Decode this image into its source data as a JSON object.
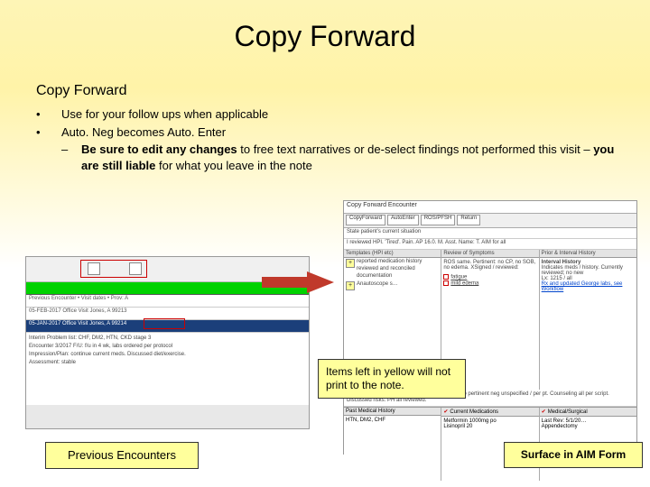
{
  "title": "Copy Forward",
  "subtitle": "Copy Forward",
  "bullets": {
    "items": [
      "Use for your follow ups when applicable",
      "Auto. Neg becomes Auto. Enter"
    ],
    "sub_prefix": "Be sure to edit any changes",
    "sub_mid": " to free text narratives or de-select findings not performed this visit – ",
    "sub_bold2": "you are still liable",
    "sub_tail": " for what you leave in the note"
  },
  "left": {
    "row1": "Previous Encounter  •  Visit dates  •  Prov: A",
    "row2": "05-FEB-2017   Office Visit   Jones, A   99213",
    "row3": "05-JAN-2017   Office Visit   Jones, A   99214",
    "body1": "Interim Problem list: CHF, DM2, HTN, CKD stage 3",
    "body2": "Encounter 3/2017 F/U: f/u in 4 wk, labs ordered per protocol",
    "body3": "Impression/Plan: continue current meds. Discussed diet/exercise.",
    "body4": "Assessment: stable"
  },
  "right": {
    "titlebar": "Copy Forward Encounter",
    "toolbar": [
      "CopyForward",
      "AutoEnter",
      "ROS/PFSH",
      "Return"
    ],
    "sub1": "State patient's current situation",
    "sub2": "I reviewed HPI.  'Tired'. Pain.  AP 16.0.  M.  Asst. Name: T. AIM for all",
    "col1_h": "Templates (HPI etc)",
    "col1_items": [
      "reported medication history reviewed and reconciled documentation",
      "Anautoscope s…"
    ],
    "col2_h": "Review of Symptoms",
    "col2_body1": "ROS same. Pertinent: no CP, no SOB, no edema. XSigned / reviewed:",
    "col2_items": [
      "fatigue",
      "mild edema"
    ],
    "col3_h": "Prior & Interval History",
    "col3_b1": "Interval History",
    "col3_b2": "Indicates meds / history. Currently reviewed; no new",
    "col3_b3": "Lx: 1215 / all",
    "col3_b4": "Rx and updated George labs, see Workflow",
    "lower_prefix": "Prior: Social and Family Hx Items 3 pos noted w/o pertinent neg unspecified / per pt. Counseling all per script. Discussed risks. PH all reviewed.",
    "lcol1_h": "Past Medical History",
    "lcol2_h": "Current Medications",
    "lcol3_h": "Medical/Surgical",
    "lcol1_b": "HTN, DM2, CHF",
    "lcol2_b1": "Metformin 1000mg po",
    "lcol2_b2": "Lisinopril 20",
    "lcol3_b1": "Last Rev: 5/1/20…",
    "lcol3_b2": "Appendectomy"
  },
  "callouts": {
    "note": "Items left in yellow will not print to the note.",
    "prev": "Previous Encounters",
    "surf": "Surface in AIM Form"
  }
}
